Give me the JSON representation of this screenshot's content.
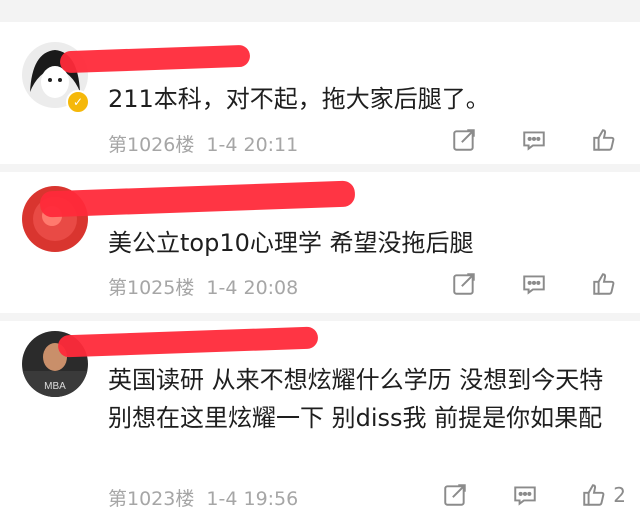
{
  "comments": [
    {
      "text": "211本科，对不起，拖大家后腿了。",
      "floor": "第1026楼",
      "date": "1-4 20:11",
      "likes": ""
    },
    {
      "text": "美公立top10心理学 希望没拖后腿",
      "floor": "第1025楼",
      "date": "1-4 20:08",
      "likes": ""
    },
    {
      "text": "英国读研 从来不想炫耀什么学历 没想到今天特别想在这里炫耀一下 别diss我 前提是你如果配",
      "floor": "第1023楼",
      "date": "1-4 19:56",
      "likes": "2"
    }
  ],
  "icons": {
    "share": "share-icon",
    "reply": "reply-icon",
    "like": "like-icon",
    "verified": "verified-badge-icon"
  },
  "colors": {
    "redaction": "#ff2a3a",
    "meta_text": "#a6a6a6",
    "verified": "#f5b80a"
  }
}
